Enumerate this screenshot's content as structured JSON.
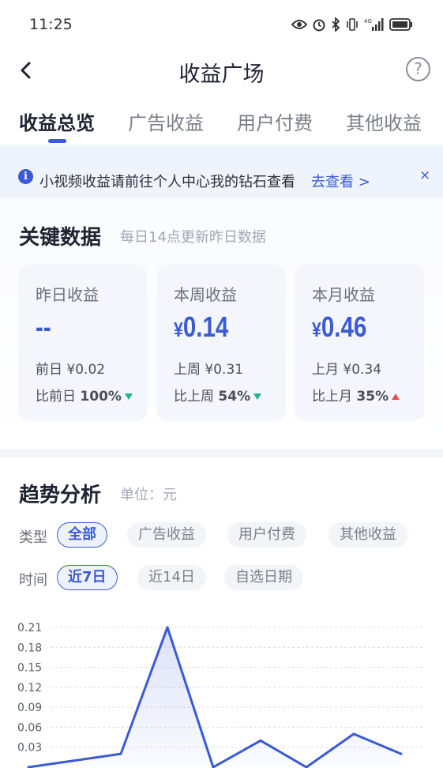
{
  "status_bar": {
    "time": "11:25"
  },
  "nav": {
    "title": "收益广场",
    "help_symbol": "?"
  },
  "tabs": [
    {
      "label": "收益总览",
      "active": true
    },
    {
      "label": "广告收益",
      "active": false
    },
    {
      "label": "用户付费",
      "active": false
    },
    {
      "label": "其他收益",
      "active": false
    }
  ],
  "notice": {
    "text": "小视频收益请前往个人中心我的钻石查看",
    "link": "去查看 >",
    "close": "×"
  },
  "key_data": {
    "title": "关键数据",
    "subtitle": "每日14点更新昨日数据",
    "cards": [
      {
        "label": "昨日收益",
        "currency": "",
        "value": "--",
        "prev": "前日 ¥0.02",
        "cmp_label": "比前日",
        "cmp_value": "100%",
        "trend": "down"
      },
      {
        "label": "本周收益",
        "currency": "¥",
        "value": "0.14",
        "prev": "上周 ¥0.31",
        "cmp_label": "比上周",
        "cmp_value": "54%",
        "trend": "down"
      },
      {
        "label": "本月收益",
        "currency": "¥",
        "value": "0.46",
        "prev": "上月 ¥0.34",
        "cmp_label": "比上月",
        "cmp_value": "35%",
        "trend": "up"
      }
    ]
  },
  "trend": {
    "title": "趋势分析",
    "unit": "单位：元",
    "type_label": "类型",
    "type_chips": [
      {
        "label": "全部",
        "active": true
      },
      {
        "label": "广告收益",
        "active": false
      },
      {
        "label": "用户付费",
        "active": false
      },
      {
        "label": "其他收益",
        "active": false
      }
    ],
    "time_label": "时间",
    "time_chips": [
      {
        "label": "近7日",
        "active": true
      },
      {
        "label": "近14日",
        "active": false
      },
      {
        "label": "自选日期",
        "active": false
      }
    ]
  },
  "colors": {
    "accent": "#3a5ad6",
    "down": "#1fb38a",
    "up": "#e2504b"
  },
  "chart_data": {
    "type": "area",
    "y_ticks": [
      "0.21",
      "0.18",
      "0.15",
      "0.12",
      "0.09",
      "0.06",
      "0.03"
    ],
    "ylim": [
      0,
      0.21
    ],
    "values": [
      0,
      0.02,
      0.21,
      0,
      0.04,
      0,
      0.05,
      0.02
    ],
    "grid": true
  }
}
